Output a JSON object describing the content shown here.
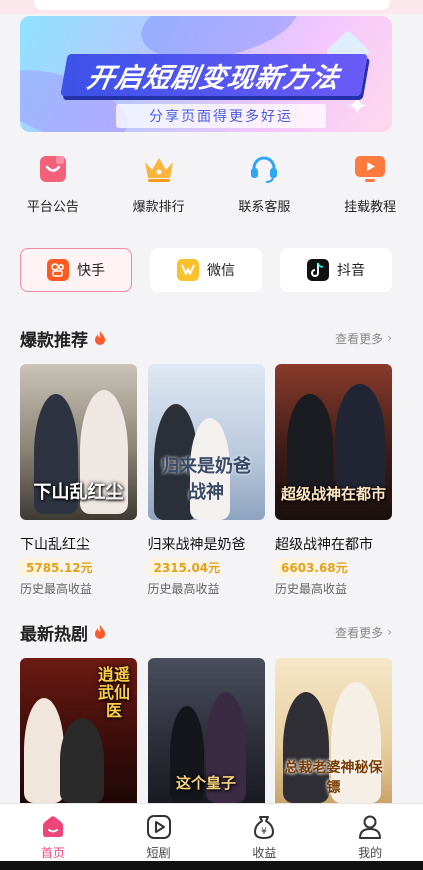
{
  "banner": {
    "title": "开启短剧变现新方法",
    "subtitle": "分享页面得更多好运"
  },
  "quick_links": [
    {
      "label": "平台公告",
      "icon": "announcement-icon"
    },
    {
      "label": "爆款排行",
      "icon": "crown-icon"
    },
    {
      "label": "联系客服",
      "icon": "headset-icon"
    },
    {
      "label": "挂载教程",
      "icon": "video-tutorial-icon"
    }
  ],
  "platforms": [
    {
      "label": "快手",
      "icon": "kuaishou-icon",
      "active": true
    },
    {
      "label": "微信",
      "icon": "wechat-icon",
      "active": false
    },
    {
      "label": "抖音",
      "icon": "douyin-icon",
      "active": false
    }
  ],
  "hot": {
    "title": "爆款推荐",
    "more": "查看更多",
    "items": [
      {
        "name": "下山乱红尘",
        "amount": "5785.12元",
        "note": "历史最高收益",
        "poster_text": "下山乱红尘"
      },
      {
        "name": "归来战神是奶爸",
        "amount": "2315.04元",
        "note": "历史最高收益",
        "poster_text": "归来是奶爸战神"
      },
      {
        "name": "超级战神在都市",
        "amount": "6603.68元",
        "note": "历史最高收益",
        "poster_text": "超级战神在都市"
      }
    ]
  },
  "latest": {
    "title": "最新热剧",
    "more": "查看更多",
    "items": [
      {
        "poster_text": "逍遥武仙医"
      },
      {
        "poster_text": "这个皇子"
      },
      {
        "poster_text": "总裁老婆神秘保镖"
      }
    ]
  },
  "tabbar": [
    {
      "label": "首页",
      "icon": "home-icon",
      "active": true
    },
    {
      "label": "短剧",
      "icon": "play-icon",
      "active": false
    },
    {
      "label": "收益",
      "icon": "money-bag-icon",
      "active": false
    },
    {
      "label": "我的",
      "icon": "user-icon",
      "active": false
    }
  ],
  "colors": {
    "accent": "#f0457a",
    "gold": "#e2a21a",
    "kuaishou": "#ff5a1f"
  }
}
